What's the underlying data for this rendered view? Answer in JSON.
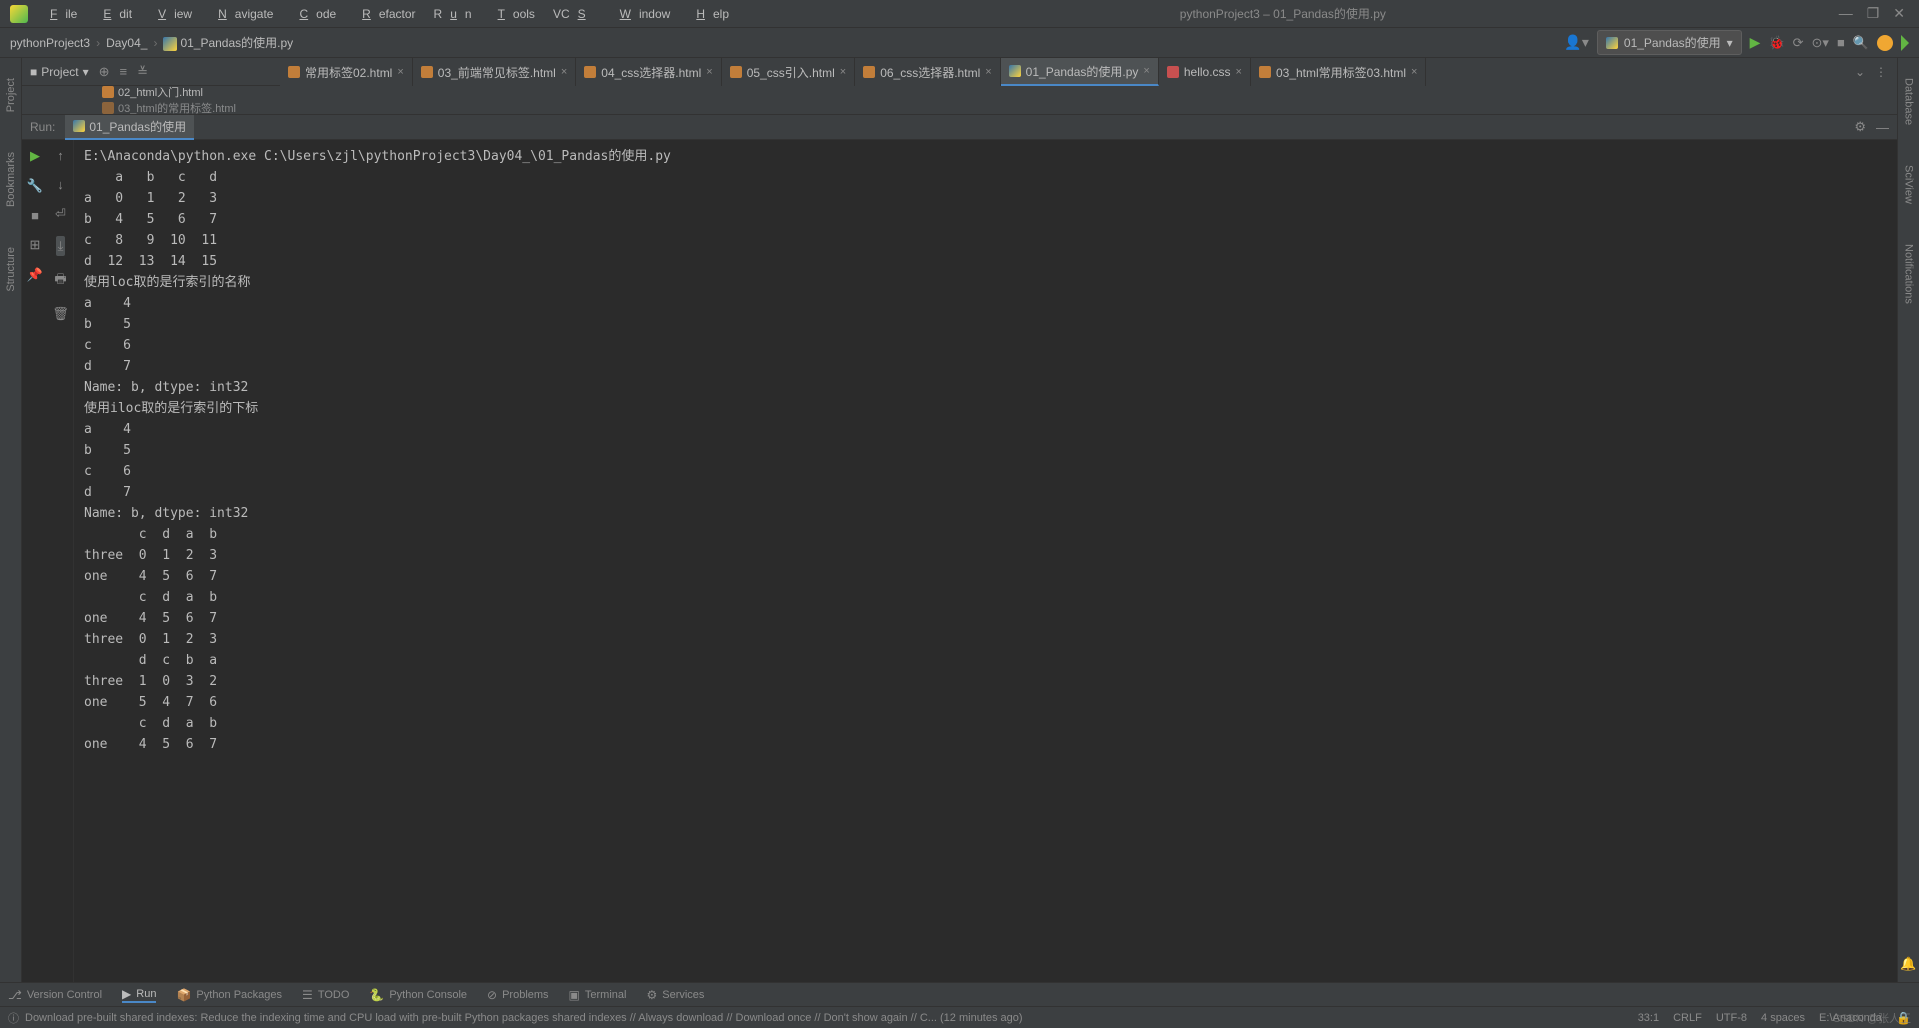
{
  "titlebar": {
    "menus": [
      "File",
      "Edit",
      "View",
      "Navigate",
      "Code",
      "Refactor",
      "Run",
      "Tools",
      "VCS",
      "Window",
      "Help"
    ],
    "center": "pythonProject3 – 01_Pandas的使用.py"
  },
  "breadcrumb": {
    "project": "pythonProject3",
    "folder": "Day04_",
    "file": "01_Pandas的使用.py"
  },
  "runconfig": {
    "name": "01_Pandas的使用"
  },
  "project_panel": {
    "label": "Project",
    "files": [
      "02_html入门.html",
      "03_html的常用标签.html"
    ]
  },
  "tabs": [
    {
      "name": "常用标签02.html",
      "type": "html"
    },
    {
      "name": "03_前端常见标签.html",
      "type": "html"
    },
    {
      "name": "04_css选择器.html",
      "type": "html"
    },
    {
      "name": "05_css引入.html",
      "type": "html"
    },
    {
      "name": "06_css选择器.html",
      "type": "html"
    },
    {
      "name": "01_Pandas的使用.py",
      "type": "py",
      "active": true
    },
    {
      "name": "hello.css",
      "type": "css"
    },
    {
      "name": "03_html常用标签03.html",
      "type": "html"
    }
  ],
  "leftrail": [
    "Project",
    "Bookmarks",
    "Structure"
  ],
  "rightrail": [
    "Database",
    "SciView",
    "Notifications"
  ],
  "run": {
    "label": "Run:",
    "tabname": "01_Pandas的使用"
  },
  "console_text": "E:\\Anaconda\\python.exe C:\\Users\\zjl\\pythonProject3\\Day04_\\01_Pandas的使用.py\n    a   b   c   d\na   0   1   2   3\nb   4   5   6   7\nc   8   9  10  11\nd  12  13  14  15\n使用loc取的是行索引的名称\na    4\nb    5\nc    6\nd    7\nName: b, dtype: int32\n使用iloc取的是行索引的下标\na    4\nb    5\nc    6\nd    7\nName: b, dtype: int32\n       c  d  a  b\nthree  0  1  2  3\none    4  5  6  7\n       c  d  a  b\none    4  5  6  7\nthree  0  1  2  3\n       d  c  b  a\nthree  1  0  3  2\none    5  4  7  6\n       c  d  a  b\none    4  5  6  7",
  "toolwins": [
    {
      "icon": "⎇",
      "label": "Version Control"
    },
    {
      "icon": "▶",
      "label": "Run",
      "active": true
    },
    {
      "icon": "📦",
      "label": "Python Packages"
    },
    {
      "icon": "☰",
      "label": "TODO"
    },
    {
      "icon": "🐍",
      "label": "Python Console"
    },
    {
      "icon": "⊘",
      "label": "Problems"
    },
    {
      "icon": "▣",
      "label": "Terminal"
    },
    {
      "icon": "⚙",
      "label": "Services"
    }
  ],
  "statusbar": {
    "msg": "Download pre-built shared indexes: Reduce the indexing time and CPU load with pre-built Python packages shared indexes // Always download // Download once // Don't show again // C... (12 minutes ago)",
    "pos": "33:1",
    "le": "CRLF",
    "enc": "UTF-8",
    "indent": "4 spaces",
    "interp": "E:\\Anaconda"
  },
  "watermark": "CSDN @张人王"
}
